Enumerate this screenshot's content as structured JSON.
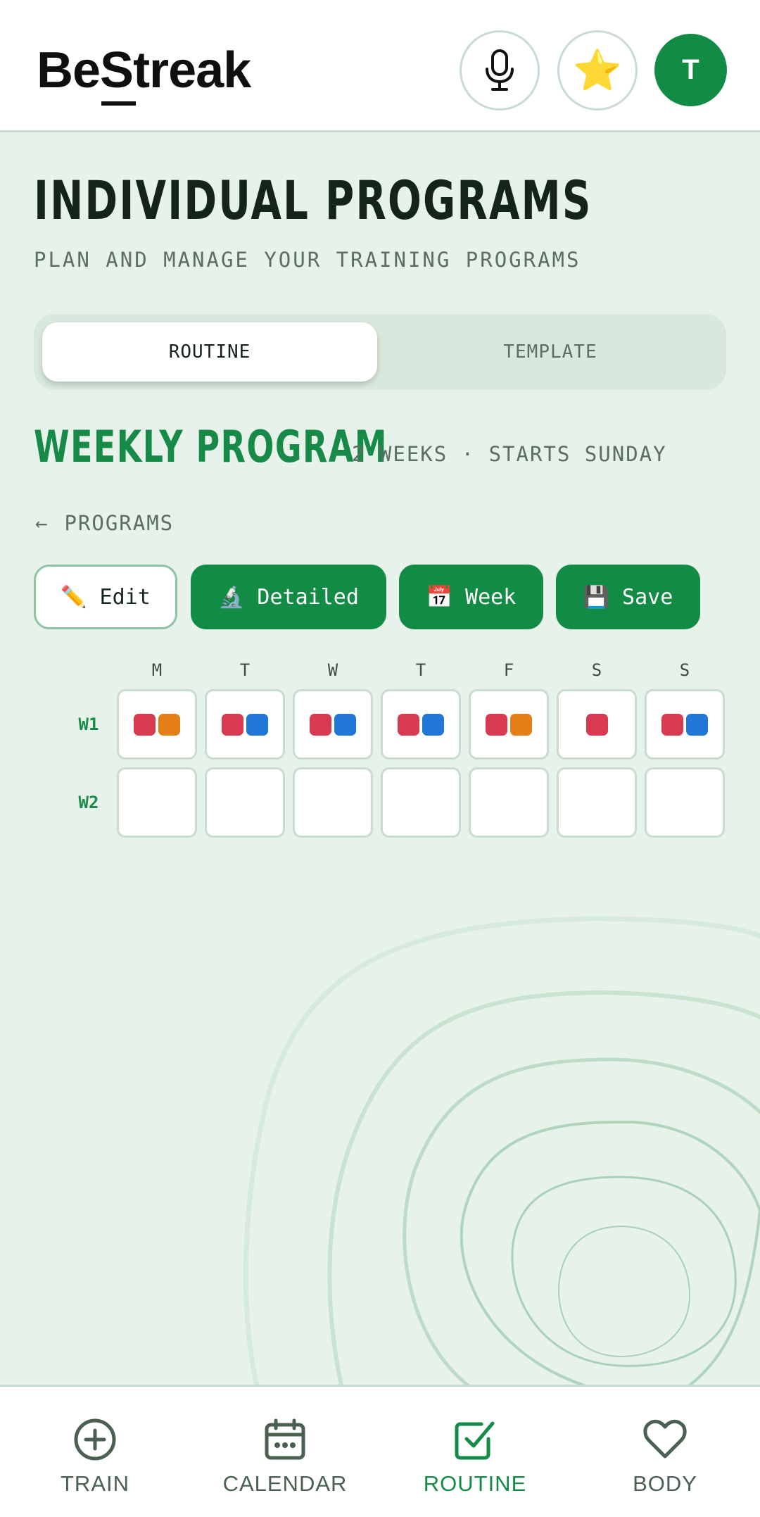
{
  "header": {
    "logo_prefix": "Be",
    "logo_underlined": "S",
    "logo_suffix": "treak",
    "mic_icon": "microphone-icon",
    "star_icon": "star-icon",
    "star_glyph": "⭐",
    "avatar_initial": "T"
  },
  "page": {
    "title": "INDIVIDUAL PROGRAMS",
    "subtitle": "PLAN AND MANAGE YOUR TRAINING PROGRAMS"
  },
  "segmented": {
    "routine": "ROUTINE",
    "template": "TEMPLATE",
    "selected": "ROUTINE"
  },
  "program": {
    "title": "WEEKLY PROGRAM",
    "meta": "2 WEEKS · STARTS SUNDAY",
    "back_arrow": "←",
    "back_label": "PROGRAMS"
  },
  "actions": {
    "edit": {
      "icon": "✏️",
      "label": "Edit"
    },
    "detailed": {
      "icon": "🔬",
      "label": "Detailed"
    },
    "week": {
      "icon": "📅",
      "label": "Week"
    },
    "save": {
      "icon": "💾",
      "label": "Save"
    }
  },
  "grid": {
    "days": [
      "M",
      "T",
      "W",
      "T",
      "F",
      "S",
      "S"
    ],
    "weeks": [
      {
        "label": "W1",
        "cells": [
          [
            "red",
            "orange"
          ],
          [
            "red",
            "blue"
          ],
          [
            "red",
            "blue"
          ],
          [
            "red",
            "blue"
          ],
          [
            "red",
            "orange"
          ],
          [
            "red"
          ],
          [
            "red",
            "blue"
          ]
        ]
      },
      {
        "label": "W2",
        "cells": [
          [],
          [],
          [],
          [],
          [],
          [],
          []
        ]
      }
    ],
    "chip_colors": {
      "red": "#d83a52",
      "orange": "#e57e17",
      "blue": "#2177d5"
    }
  },
  "nav": {
    "items": [
      {
        "label": "TRAIN",
        "icon": "plus-circle-icon"
      },
      {
        "label": "CALENDAR",
        "icon": "calendar-icon"
      },
      {
        "label": "ROUTINE",
        "icon": "checkbox-icon"
      },
      {
        "label": "BODY",
        "icon": "heart-icon"
      }
    ],
    "active": "ROUTINE"
  },
  "colors": {
    "accent": "#128b45",
    "background": "#e7f2ea",
    "muted_text": "#5b6e62"
  }
}
